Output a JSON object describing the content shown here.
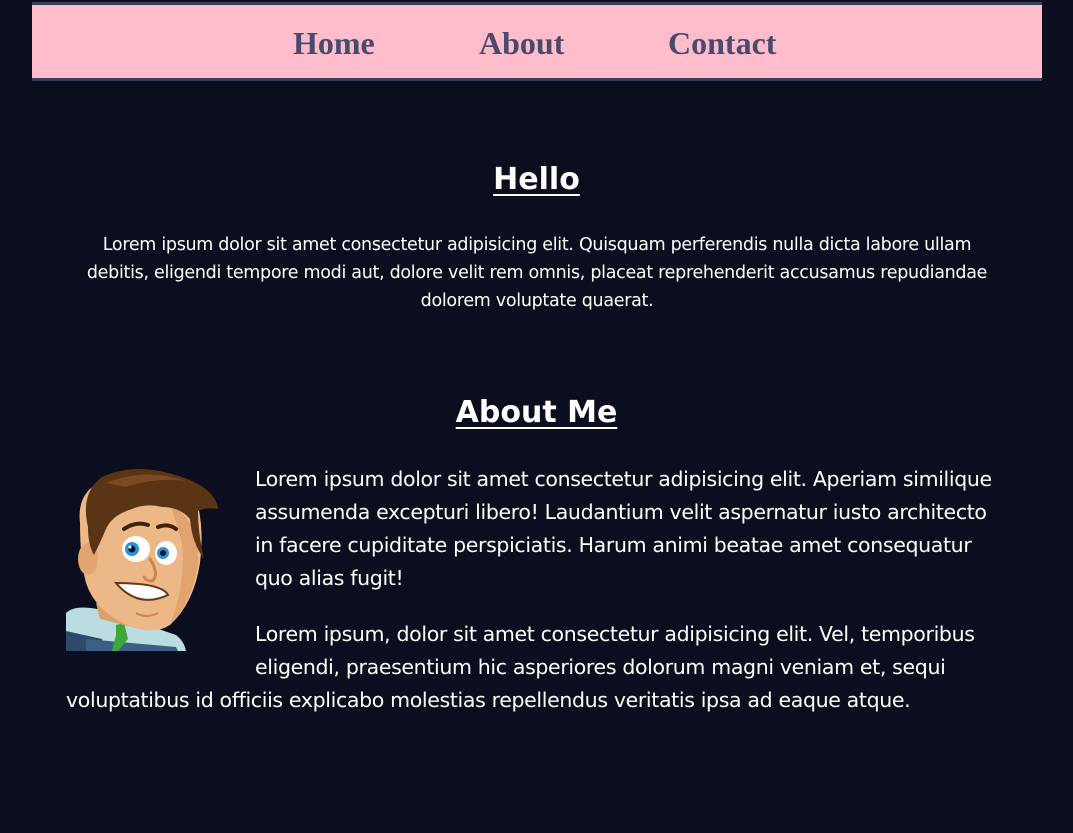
{
  "nav": {
    "home": "Home",
    "about": "About",
    "contact": "Contact"
  },
  "hello": {
    "title": "Hello",
    "text": "Lorem ipsum dolor sit amet consectetur adipisicing elit. Quisquam perferendis nulla dicta labore ullam debitis, eligendi tempore modi aut, dolore velit rem omnis, placeat reprehenderit accusamus repudiandae dolorem voluptate quaerat."
  },
  "about": {
    "title": "About Me",
    "avatar_icon": "cartoon-man-avatar",
    "paragraph1": "Lorem ipsum dolor sit amet consectetur adipisicing elit. Aperiam similique assumenda excepturi libero! Laudantium velit aspernatur iusto architecto in facere cupiditate perspiciatis. Harum animi beatae amet consequatur quo alias fugit!",
    "paragraph2": "Lorem ipsum, dolor sit amet consectetur adipisicing elit. Vel, temporibus eligendi, praesentium hic asperiores dolorum magni veniam et, sequi voluptatibus id officiis explicabo molestias repellendus veritatis ipsa ad eaque atque."
  },
  "colors": {
    "background": "#0a0e1e",
    "nav_background": "#ffbccb",
    "nav_text": "#4a4a6e",
    "text": "#ffffff"
  }
}
